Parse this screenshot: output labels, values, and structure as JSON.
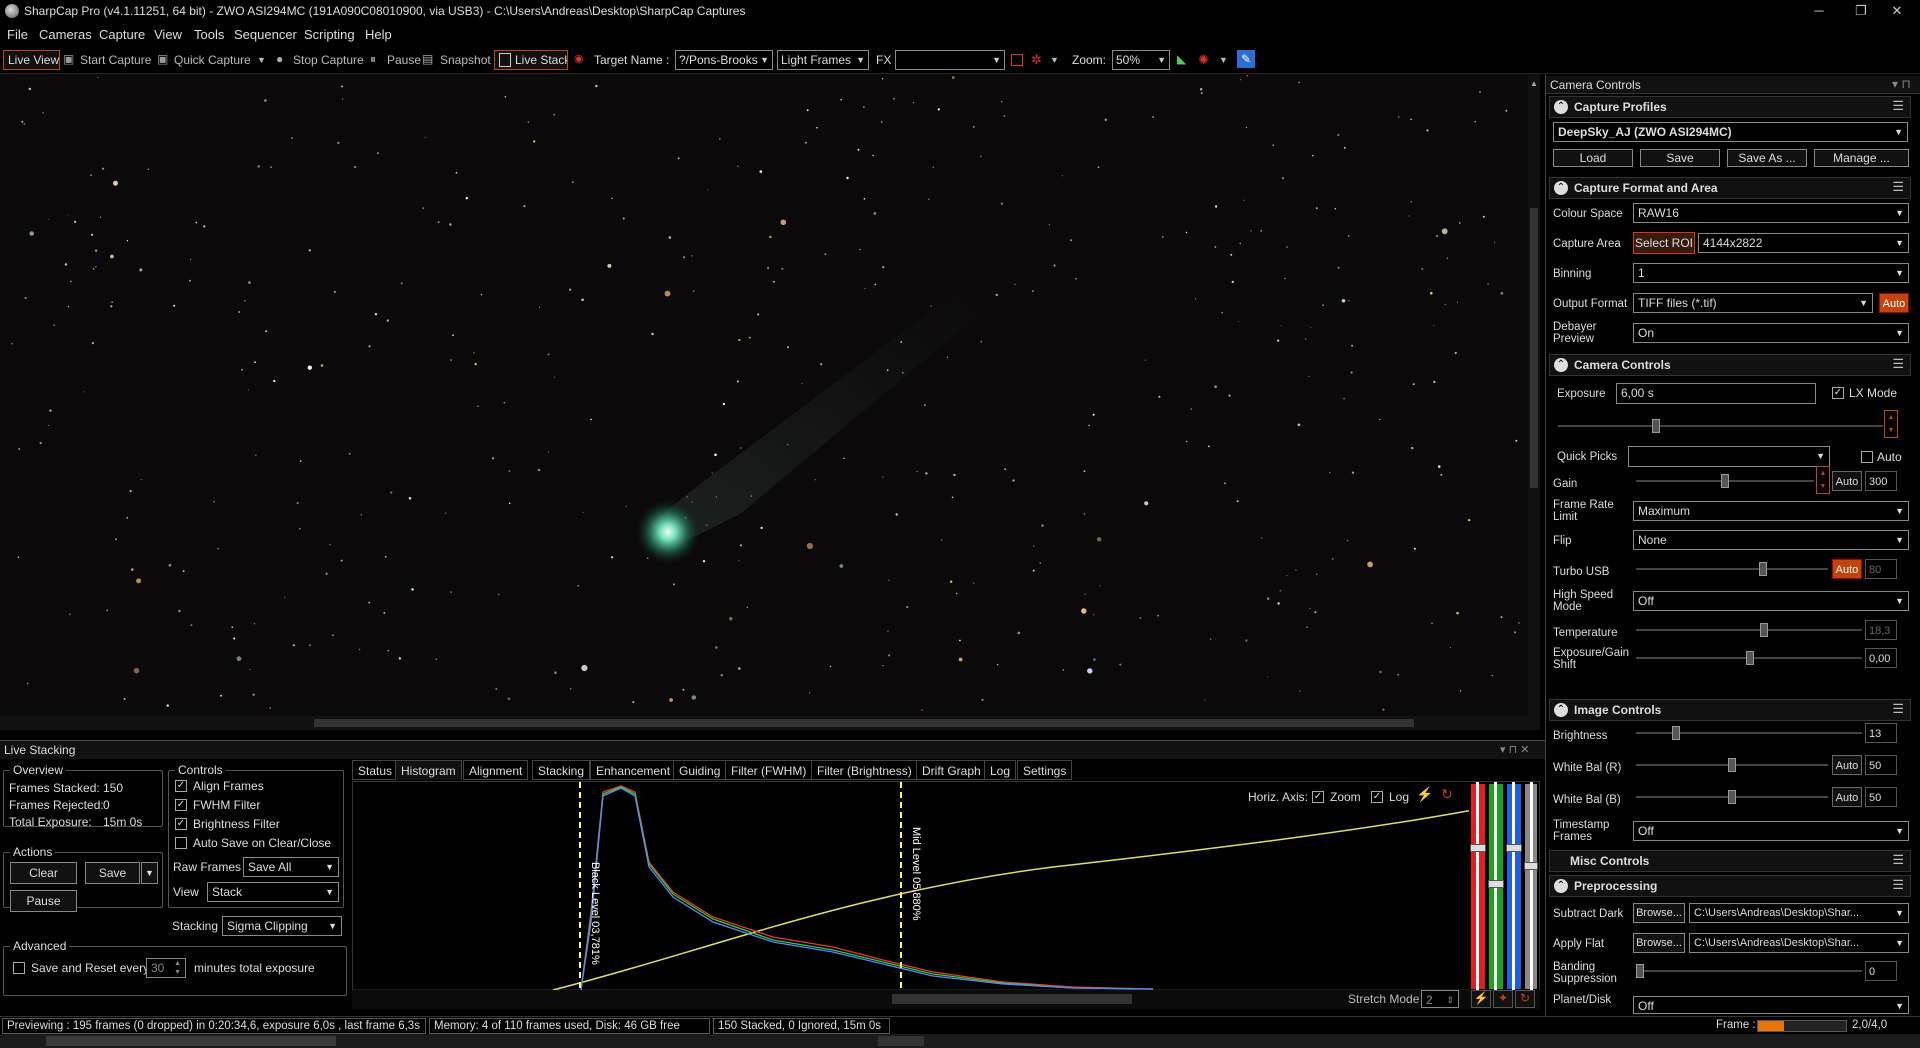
{
  "titlebar": {
    "title": "SharpCap Pro (v4.1.11251, 64 bit) - ZWO ASI294MC (191A090C08010900, via USB3) - C:\\Users\\Andreas\\Desktop\\SharpCap Captures",
    "minimize": "─",
    "restore": "❐",
    "close": "✕"
  },
  "menu": [
    "File",
    "Cameras",
    "Capture",
    "View",
    "Tools",
    "Sequencer",
    "Scripting",
    "Help"
  ],
  "toolbar": {
    "live_view": "Live View",
    "start_capture": "Start Capture",
    "quick_capture": "Quick Capture",
    "stop_capture": "Stop Capture",
    "pause": "Pause",
    "snapshot": "Snapshot",
    "live_stack": "Live Stack",
    "target_label": "Target Name :",
    "target_value": "?/Pons-Brooks",
    "frame_type": "Light Frames",
    "fx": "FX",
    "fx_value": "",
    "zoom_label": "Zoom:",
    "zoom_value": "50%"
  },
  "live_stacking": {
    "title": "Live Stacking",
    "overview": {
      "legend": "Overview",
      "frames_stacked_label": "Frames Stacked:",
      "frames_stacked": "150",
      "frames_rejected_label": "Frames Rejected:",
      "frames_rejected": "0",
      "total_exposure_label": "Total Exposure:",
      "total_exposure": "15m 0s"
    },
    "actions": {
      "legend": "Actions",
      "clear": "Clear",
      "save": "Save",
      "pause": "Pause"
    },
    "controls": {
      "legend": "Controls",
      "align_frames": "Align Frames",
      "fwhm_filter": "FWHM Filter",
      "brightness_filter": "Brightness Filter",
      "auto_save": "Auto Save on Clear/Close",
      "raw_frames_label": "Raw Frames",
      "raw_frames": "Save All",
      "view_label": "View",
      "view": "Stack",
      "stacking_label": "Stacking",
      "stacking": "Sigma Clipping"
    },
    "advanced": {
      "legend": "Advanced",
      "save_reset_label": "Save and Reset every",
      "minutes": "30",
      "minutes_suffix": "minutes total exposure"
    },
    "tabs": [
      "Status",
      "Histogram",
      "Alignment",
      "Stacking",
      "Enhancement",
      "Guiding",
      "Filter (FWHM)",
      "Filter (Brightness)",
      "Drift Graph",
      "Log",
      "Settings"
    ],
    "active_tab": 1,
    "histogram": {
      "horiz_axis": "Horiz. Axis:",
      "zoom": "Zoom",
      "log": "Log",
      "black_level": "Black Level  03,781%",
      "mid_level": "Mid Level  05,880%",
      "stretch_mode": "Stretch Mode",
      "stretch_value": "2"
    }
  },
  "camera_controls": {
    "panel_title": "Camera Controls",
    "capture_profiles": {
      "header": "Capture Profiles",
      "profile": "DeepSky_AJ (ZWO ASI294MC)",
      "load": "Load",
      "save": "Save",
      "save_as": "Save As ...",
      "manage": "Manage ..."
    },
    "format": {
      "header": "Capture Format and Area",
      "colour_space_label": "Colour Space",
      "colour_space": "RAW16",
      "capture_area_label": "Capture Area",
      "select_roi": "Select ROI",
      "capture_area": "4144x2822",
      "binning_label": "Binning",
      "binning": "1",
      "output_format_label": "Output Format",
      "output_format": "TIFF files (*.tif)",
      "auto": "Auto",
      "debayer_label_1": "Debayer",
      "debayer_label_2": "Preview",
      "debayer": "On"
    },
    "camera": {
      "header": "Camera Controls",
      "exposure_label": "Exposure",
      "exposure": "6,00 s",
      "lx_mode": "LX Mode",
      "quick_picks_label": "Quick Picks",
      "quick_picks": "",
      "auto": "Auto",
      "gain_label": "Gain",
      "gain": "300",
      "frame_rate_label_1": "Frame Rate",
      "frame_rate_label_2": "Limit",
      "frame_rate": "Maximum",
      "flip_label": "Flip",
      "flip": "None",
      "turbo_usb_label": "Turbo USB",
      "turbo_usb": "80",
      "high_speed_label_1": "High Speed",
      "high_speed_label_2": "Mode",
      "high_speed": "Off",
      "temperature_label": "Temperature",
      "temperature": "18,3",
      "exp_gain_shift_label_1": "Exposure/Gain",
      "exp_gain_shift_label_2": "Shift",
      "exp_gain_shift": "0,00"
    },
    "image": {
      "header": "Image Controls",
      "brightness_label": "Brightness",
      "brightness": "13",
      "wb_r_label": "White Bal (R)",
      "wb_r": "50",
      "wb_b_label": "White Bal (B)",
      "wb_b": "50",
      "auto": "Auto",
      "timestamp_label_1": "Timestamp",
      "timestamp_label_2": "Frames",
      "timestamp": "Off"
    },
    "misc": {
      "header": "Misc Controls"
    },
    "preprocessing": {
      "header": "Preprocessing",
      "subtract_dark_label": "Subtract Dark",
      "browse": "Browse...",
      "subtract_dark": "C:\\Users\\Andreas\\Desktop\\Shar...",
      "apply_flat_label": "Apply Flat",
      "apply_flat": "C:\\Users\\Andreas\\Desktop\\Shar...",
      "banding_label_1": "Banding",
      "banding_label_2": "Suppression",
      "banding": "0",
      "planet_disk_label": "Planet/Disk",
      "planet_disk": "Off"
    }
  },
  "status": {
    "previewing": "Previewing : 195 frames (0 dropped) in 0:20:34,6, exposure 6,0s , last frame 6,3s",
    "memory": "Memory: 4 of 110 frames used, Disk: 46 GB free",
    "stacked": "150 Stacked, 0 Ignored, 15m 0s",
    "frame_label": "Frame :",
    "frame_progress": 0.3,
    "frame_value": "2,0/4,0"
  },
  "colors": {
    "accent": "#c1440e",
    "background": "#000000",
    "histogram_yellow": "#ffff66"
  }
}
